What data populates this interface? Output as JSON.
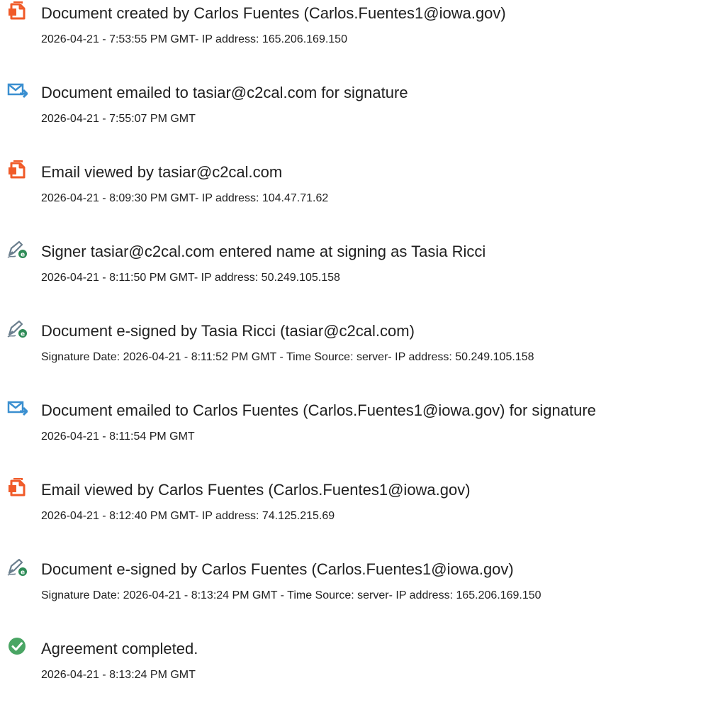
{
  "events": [
    {
      "icon": "document-icon",
      "title": "Document created by Carlos Fuentes (Carlos.Fuentes1@iowa.gov)",
      "detail": "2026-04-21 - 7:53:55 PM GMT- IP address: 165.206.169.150"
    },
    {
      "icon": "email-sent-icon",
      "title": "Document emailed to tasiar@c2cal.com for signature",
      "detail": "2026-04-21 - 7:55:07 PM GMT"
    },
    {
      "icon": "document-icon",
      "title": "Email viewed by tasiar@c2cal.com",
      "detail": "2026-04-21 - 8:09:30 PM GMT- IP address: 104.47.71.62"
    },
    {
      "icon": "esign-pen-icon",
      "title": "Signer tasiar@c2cal.com entered name at signing as Tasia Ricci",
      "detail": "2026-04-21 - 8:11:50 PM GMT- IP address: 50.249.105.158"
    },
    {
      "icon": "esign-pen-icon",
      "title": "Document e-signed by Tasia Ricci (tasiar@c2cal.com)",
      "detail": "Signature Date: 2026-04-21 - 8:11:52 PM GMT - Time Source: server- IP address: 50.249.105.158"
    },
    {
      "icon": "email-sent-icon",
      "title": "Document emailed to Carlos Fuentes (Carlos.Fuentes1@iowa.gov) for signature",
      "detail": "2026-04-21 - 8:11:54 PM GMT"
    },
    {
      "icon": "document-icon",
      "title": "Email viewed by Carlos Fuentes (Carlos.Fuentes1@iowa.gov)",
      "detail": "2026-04-21 - 8:12:40 PM GMT- IP address: 74.125.215.69"
    },
    {
      "icon": "esign-pen-icon",
      "title": "Document e-signed by Carlos Fuentes (Carlos.Fuentes1@iowa.gov)",
      "detail": "Signature Date: 2026-04-21 - 8:13:24 PM GMT - Time Source: server- IP address: 165.206.169.150"
    },
    {
      "icon": "check-circle-icon",
      "title": "Agreement completed.",
      "detail": "2026-04-21 - 8:13:24 PM GMT"
    }
  ],
  "colors": {
    "document_icon": "#f05a28",
    "email_icon": "#3a8fd0",
    "pen_icon_outline": "#6b7f8e",
    "pen_icon_badge": "#2e8b57",
    "check_icon": "#4aa564",
    "text": "#1f1f1f"
  }
}
